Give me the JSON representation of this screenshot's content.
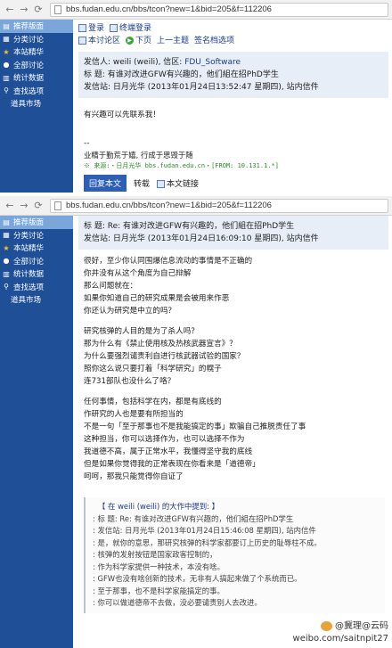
{
  "url": "bbs.fudan.edu.cn/bbs/tcon?new=1&bid=205&f=112206",
  "sidebar": {
    "items": [
      {
        "label": "推荐版面",
        "icon": "recommend-icon"
      },
      {
        "label": "分类讨论",
        "icon": "category-icon"
      },
      {
        "label": "本站精华",
        "icon": "star-icon"
      },
      {
        "label": "全部讨论",
        "icon": "all-discussions-icon"
      },
      {
        "label": "统计数据",
        "icon": "stats-icon"
      },
      {
        "label": "查找选项",
        "icon": "search-icon"
      },
      {
        "label": "道具市场",
        "icon": ""
      }
    ]
  },
  "topbar": {
    "login": "登录",
    "terminal_login": "终端登录",
    "board_discuss": "本讨论区",
    "next_page": "下页",
    "prev_topic": "上一主题",
    "sign_options": "签名档选项"
  },
  "post1": {
    "sender": "发信人: weili (weili), 信区: ",
    "board": "FDU_Software",
    "title": "标  题: 有谁对改进GFW有兴趣的，他们組在招PhD学生",
    "site": "发信站: 日月光华 (2013年01月24日13:52:47 星期四), 站内信件",
    "body": "有兴趣可以先联系我！",
    "separator": "--",
    "signature": "业精于勤荒于嬉, 行成于思毁于随",
    "source": "※ 来源:・日月光华 bbs.fudan.edu.cn・[FROM: 10.131.1.*]",
    "reply_label": "回复本文",
    "forward_label": "转载",
    "text_link_label": "本文链接"
  },
  "post2": {
    "title": "标  题: Re: 有谁对改进GFW有兴趣的，他们組在招PhD学生",
    "site": "发信站: 日月光华 (2013年01月24日16:09:10 星期四), 站内信件",
    "paragraphs": [
      [
        "很好，至少你认同围爆信息流动的事情是不正确的",
        "你并没有从这个角度为自己辩解",
        "那么问题就在：",
        "如果你知道自己的研究成果是会被用来作恶",
        "你还认为研究是中立的吗？"
      ],
      [
        "研究核弹的人目的是为了杀人吗？",
        "那为什么有《禁止使用核及热核武器宣言》？",
        "为什么要强烈谴责利自进行核武器试验的国家？",
        "照你这么说只要打着「科学研究」的幌子",
        "连731部队也没什么了咯？"
      ],
      [
        "任何事情，包括科学在内，都是有底线的",
        "作研究的人也是要有所担当的",
        "不是一句「至于那事也不是我能搞定的事」欺骗自己推脱责任了事",
        "这种担当，你可以选择作为，也可以选择不作为",
        "我道德不高，属于正常水平，我懂得坚守我的底线",
        "但是如果你觉得我的正常表现在你看来是「道德帝」",
        "呵呵，那我只能觉得你自证了"
      ]
    ],
    "quote_header": "【 在 weili (weili) 的大作中提到: 】",
    "quote_lines": [
      ": 标  题: Re: 有谁对改进GFW有兴趣的，他们組在招PhD学生",
      ": 发信站: 日月光华 (2013年01月24日15:46:08 星期四), 站内信件",
      ": 是，就你的意思，那研究核弹的科学家都要订上历史的耻辱柱不成。",
      ": 核弹的发射按钮是国家政客控制的，",
      ": 作为科学家提供一种技术，本没有啥。",
      ": GFW也没有啥创新的技术，无非有人搞起来做了个系统而已。",
      ": 至于那事，也不是科学家能搞定的事。",
      ": 你可以做道德帝不去做，没必要谴责别人去改进。"
    ]
  },
  "watermark": {
    "line1": "@冀理@云码",
    "line2": "weibo.com/saitnpit27"
  }
}
